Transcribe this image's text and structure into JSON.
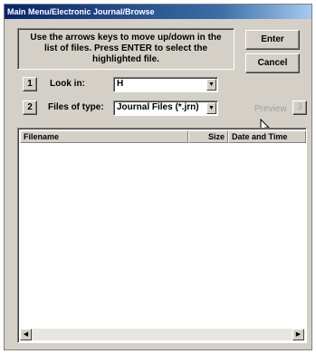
{
  "window": {
    "title": "Main Menu/Electronic Journal/Browse"
  },
  "instructions": {
    "text": "Use the arrows keys to move up/down in the list of files.  Press ENTER to select the highlighted file."
  },
  "buttons": {
    "enter_label": "Enter",
    "cancel_label": "Cancel",
    "look_in_num": "1",
    "file_type_num": "2",
    "preview_label": "Preview",
    "preview_num": "3"
  },
  "look_in": {
    "label": "Look in:",
    "value": "H"
  },
  "file_type": {
    "label": "Files of type:",
    "value": "Journal Files (*.jrn)"
  },
  "file_list": {
    "columns": [
      "Filename",
      "Size",
      "Date and Time"
    ],
    "rows": []
  },
  "icons": {
    "dropdown": "chevron-down-icon",
    "scroll_left": "arrow-left-icon",
    "scroll_right": "arrow-right-icon",
    "cursor": "mouse-pointer-icon"
  },
  "colors": {
    "titlebar_start": "#0a246a",
    "titlebar_end": "#a6caf0",
    "face": "#d4d0c8",
    "disabled_text": "#a0a0a0"
  }
}
